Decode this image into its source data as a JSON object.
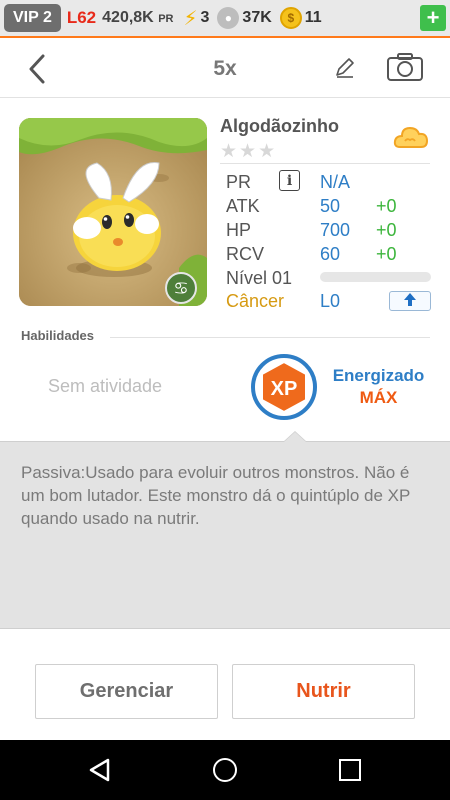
{
  "status": {
    "vip": "VIP 2",
    "level": "L62",
    "power": "420,8K",
    "power_unit": "PR",
    "energy": "3",
    "food": "37K",
    "coins": "11",
    "add_label": "+"
  },
  "header": {
    "multiplier": "5x",
    "back_icon": "back-chevron-icon",
    "edit_icon": "pencil-icon",
    "camera_icon": "camera-icon"
  },
  "monster": {
    "name": "Algodãozinho",
    "stars": "★★★",
    "element_icon": "cloud-icon",
    "stats": {
      "pr_label": "PR",
      "pr_value": "N/A",
      "atk_label": "ATK",
      "atk_value": "50",
      "atk_bonus": "+0",
      "hp_label": "HP",
      "hp_value": "700",
      "hp_bonus": "+0",
      "rcv_label": "RCV",
      "rcv_value": "60",
      "rcv_bonus": "+0",
      "level_label": "Nível 01",
      "level_progress": 0
    },
    "sign": "Câncer",
    "league": "L0"
  },
  "abilities": {
    "title": "Habilidades",
    "no_activity": "Sem atividade",
    "badge": "XP",
    "energized": "Energizado",
    "max": "MÁX"
  },
  "description": "Passiva:Usado para evoluir outros monstros. Não é um bom lutador. Este monstro dá o quintúplo de XP quando usado na nutrir.",
  "actions": {
    "manage": "Gerenciar",
    "feed": "Nutrir"
  },
  "colors": {
    "accent_orange": "#e8551c",
    "stat_blue": "#2e7ec6",
    "bonus_green": "#3cb53c",
    "sign_gold": "#d69a12"
  }
}
